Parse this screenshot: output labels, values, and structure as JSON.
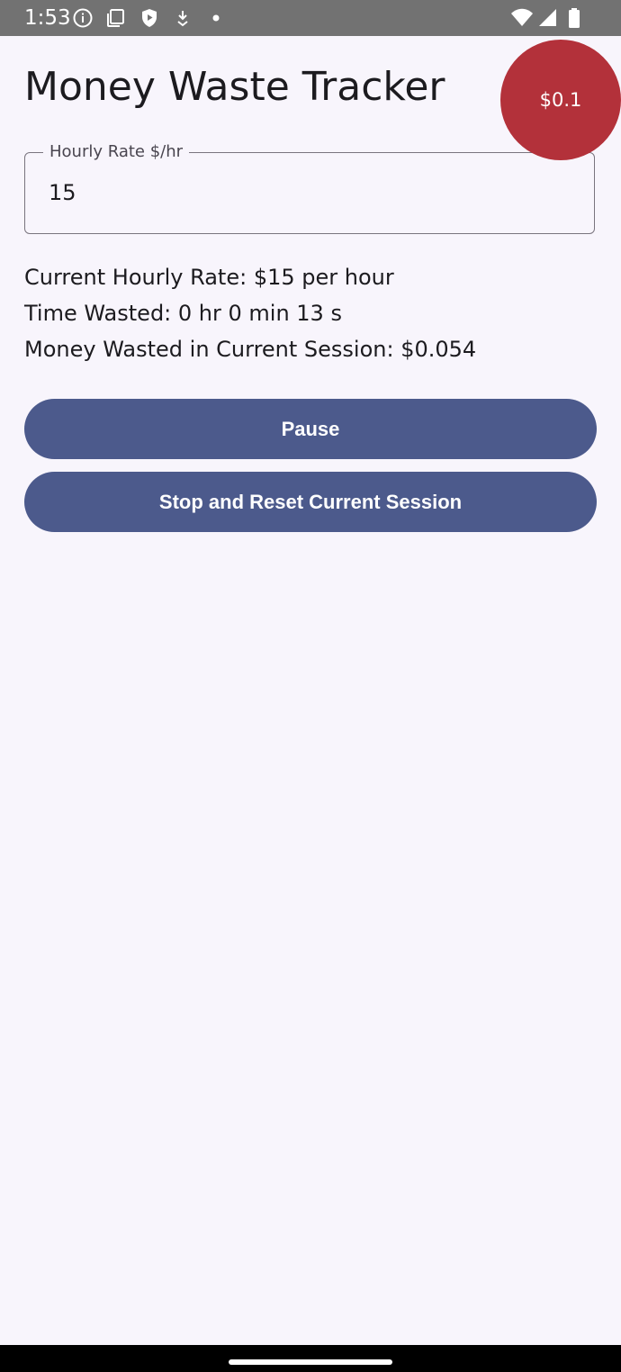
{
  "status_bar": {
    "time": "1:53",
    "left_icons": [
      "info-icon",
      "clipboard-icon",
      "shield-play-icon",
      "download-icon",
      "dot-icon"
    ],
    "right_icons": [
      "wifi-icon",
      "signal-icon",
      "battery-icon"
    ]
  },
  "app": {
    "title": "Money Waste Tracker"
  },
  "bubble": {
    "amount": "$0.1",
    "color": "#b3313a"
  },
  "hourly_rate_field": {
    "label": "Hourly Rate $/hr",
    "value": "15"
  },
  "info": {
    "current_rate": "Current Hourly Rate: $15 per hour",
    "time_wasted": "Time Wasted: 0 hr 0 min 13 s",
    "money_wasted": "Money Wasted in Current Session: $0.054"
  },
  "buttons": {
    "pause_label": "Pause",
    "stop_reset_label": "Stop and Reset Current Session",
    "color": "#4c5a8c"
  }
}
